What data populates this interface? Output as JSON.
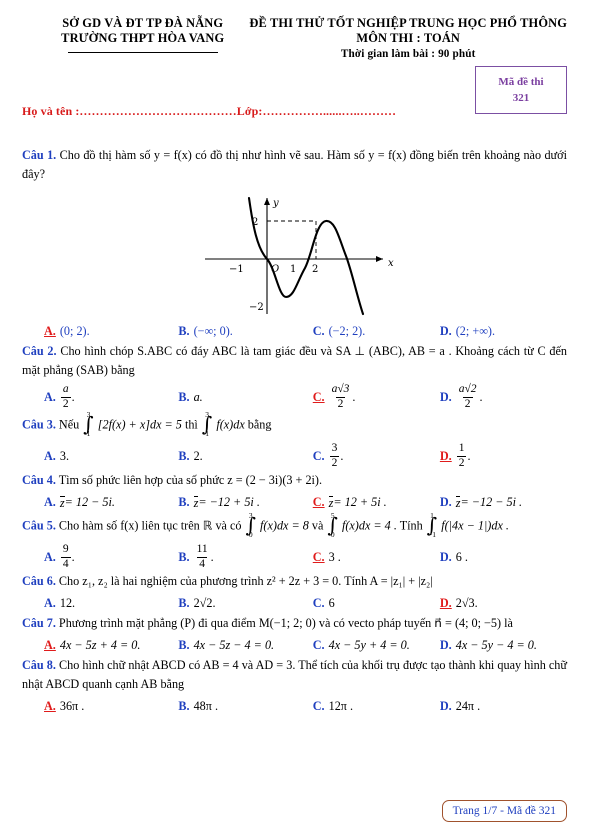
{
  "header": {
    "left_line1": "SỞ GD VÀ ĐT TP ĐÀ NẴNG",
    "left_line2": "TRƯỜNG THPT HÒA VANG",
    "right_line1": "ĐỀ THI THỬ TỐT NGHIỆP TRUNG HỌC PHỔ THÔNG",
    "right_line2": "MÔN THI : TOÁN",
    "right_line3": "Thời gian làm bài : 90 phút",
    "code_label": "Mã đề thi",
    "code_value": "321",
    "name_field": "Họ và tên :…………………………………Lớp:……………......…..………"
  },
  "colors": {
    "question_label": "#1f3fbf",
    "option_text": "#1f3fbf",
    "correct": "#e01b1b",
    "code_box": "#7b3fa0",
    "name_line": "#d81b1b",
    "footer_border": "#a0522d"
  },
  "questions": [
    {
      "label": "Câu 1.",
      "stem": "Cho đồ thị hàm số  y = f(x)  có đồ thị như hình vẽ sau. Hàm số  y = f(x)  đồng biến trên khoảng nào dưới đây?",
      "correct": "A",
      "options": [
        {
          "key": "A.",
          "text": "(0; 2)."
        },
        {
          "key": "B.",
          "text": "(−∞; 0)."
        },
        {
          "key": "C.",
          "text": "(−2; 2)."
        },
        {
          "key": "D.",
          "text": "(2; +∞)."
        }
      ]
    },
    {
      "label": "Câu 2.",
      "stem": "Cho hình chóp S.ABC có đáy  ABC  là tam giác đều và  SA ⊥ (ABC), AB = a . Khoảng cách từ C đến mặt phẳng (SAB) bằng",
      "correct": "C",
      "options": [
        {
          "key": "A.",
          "num": "a",
          "den": "2",
          "suffix": "."
        },
        {
          "key": "B.",
          "text": "a."
        },
        {
          "key": "C.",
          "num": "a√3",
          "den": "2",
          "suffix": "."
        },
        {
          "key": "D.",
          "num": "a√2",
          "den": "2",
          "suffix": "."
        }
      ]
    },
    {
      "label": "Câu 3.",
      "stem_pre": "Nếu",
      "int1": {
        "upper": "3",
        "lower": "1",
        "body": "[2f(x) + x]dx = 5"
      },
      "stem_mid": "thì",
      "int2": {
        "upper": "3",
        "lower": "1",
        "body": "f(x)dx"
      },
      "stem_post": "bằng",
      "correct": "D",
      "options": [
        {
          "key": "A.",
          "text": "3."
        },
        {
          "key": "B.",
          "text": "2."
        },
        {
          "key": "C.",
          "num": "3",
          "den": "2",
          "suffix": "."
        },
        {
          "key": "D.",
          "num": "1",
          "den": "2",
          "suffix": "."
        }
      ]
    },
    {
      "label": "Câu 4.",
      "stem": "Tìm số phức liên hợp của số phức  z = (2 − 3i)(3 + 2i).",
      "correct": "C",
      "options": [
        {
          "key": "A.",
          "conj": "z",
          "text": " = 12 − 5i."
        },
        {
          "key": "B.",
          "conj": "z",
          "text": " = −12 + 5i ."
        },
        {
          "key": "C.",
          "conj": "z",
          "text": " = 12 + 5i ."
        },
        {
          "key": "D.",
          "conj": "z",
          "text": " = −12 − 5i ."
        }
      ]
    },
    {
      "label": "Câu 5.",
      "stem_pre": "Cho hàm số  f(x)  liên tục trên ℝ  và có",
      "int1": {
        "upper": "3",
        "lower": "0",
        "body": "f(x)dx = 8"
      },
      "stem_mid": "và",
      "int2": {
        "upper": "5",
        "lower": "0",
        "body": "f(x)dx = 4 ."
      },
      "stem_mid2": "Tính",
      "int3": {
        "upper": "1",
        "lower": "−1",
        "body": "f(|4x − 1|)dx ."
      },
      "correct": "C",
      "options": [
        {
          "key": "A.",
          "num": "9",
          "den": "4",
          "suffix": "."
        },
        {
          "key": "B.",
          "num": "11",
          "den": "4",
          "suffix": "."
        },
        {
          "key": "C.",
          "text": "3 ."
        },
        {
          "key": "D.",
          "text": "6 ."
        }
      ]
    },
    {
      "label": "Câu 6.",
      "stem": "Cho  z₁, z₂ là hai nghiệm của phương trình  z² + 2z + 3 = 0. Tính  A = |z₁| + |z₂|",
      "correct": "D",
      "options": [
        {
          "key": "A.",
          "text": "12."
        },
        {
          "key": "B.",
          "text": "2√2."
        },
        {
          "key": "C.",
          "text": "6"
        },
        {
          "key": "D.",
          "text": "2√3."
        }
      ]
    },
    {
      "label": "Câu 7.",
      "stem": "Phương trình mặt phẳng (P) đi qua điểm  M(−1; 2; 0) và có vecto pháp tuyến  n⃗ = (4; 0; −5) là",
      "correct": "A",
      "options": [
        {
          "key": "A.",
          "text": "4x − 5z + 4 = 0."
        },
        {
          "key": "B.",
          "text": "4x − 5z − 4 = 0."
        },
        {
          "key": "C.",
          "text": "4x − 5y + 4 = 0."
        },
        {
          "key": "D.",
          "text": "4x − 5y − 4 = 0."
        }
      ]
    },
    {
      "label": "Câu 8.",
      "stem": "Cho hình chữ nhật  ABCD có  AB = 4  và  AD = 3. Thể tích của khối trụ được tạo thành khi quay hình chữ nhật  ABCD  quanh cạnh  AB  bằng",
      "correct": "A",
      "options": [
        {
          "key": "A.",
          "text": "36π ."
        },
        {
          "key": "B.",
          "text": "48π ."
        },
        {
          "key": "C.",
          "text": "12π ."
        },
        {
          "key": "D.",
          "text": "24π ."
        }
      ]
    }
  ],
  "chart_data": {
    "type": "line",
    "title": "",
    "xlabel": "x",
    "ylabel": "y",
    "xlim": [
      -1.6,
      3.2
    ],
    "ylim": [
      -3.4,
      3.4
    ],
    "x_ticks": [
      -1,
      1,
      2
    ],
    "y_ticks": [
      2,
      -2
    ],
    "origin_label": "O",
    "grid": false,
    "annotations": [
      "dashed line from y=2 to local max at (2,2)",
      "dashed vertical line at x=2"
    ],
    "description": "Cubic curve with local minimum at (0,-2) and local maximum at (2,2)",
    "points": [
      [
        -1.35,
        3.4
      ],
      [
        -1.2,
        1.9
      ],
      [
        -1.0,
        0.55
      ],
      [
        -0.8,
        -0.55
      ],
      [
        -0.6,
        -1.35
      ],
      [
        -0.4,
        -1.8
      ],
      [
        -0.2,
        -1.98
      ],
      [
        0.0,
        -2.0
      ],
      [
        0.2,
        -1.88
      ],
      [
        0.4,
        -1.6
      ],
      [
        0.6,
        -1.2
      ],
      [
        0.8,
        -0.7
      ],
      [
        1.0,
        0.0
      ],
      [
        1.2,
        0.6
      ],
      [
        1.4,
        1.15
      ],
      [
        1.6,
        1.6
      ],
      [
        1.8,
        1.9
      ],
      [
        2.0,
        2.0
      ],
      [
        2.2,
        1.9
      ],
      [
        2.4,
        1.5
      ],
      [
        2.6,
        0.85
      ],
      [
        2.8,
        -0.15
      ],
      [
        3.0,
        -1.5
      ],
      [
        3.12,
        -2.6
      ]
    ]
  },
  "footer": {
    "text": "Trang 1/7 - Mã đề 321"
  }
}
